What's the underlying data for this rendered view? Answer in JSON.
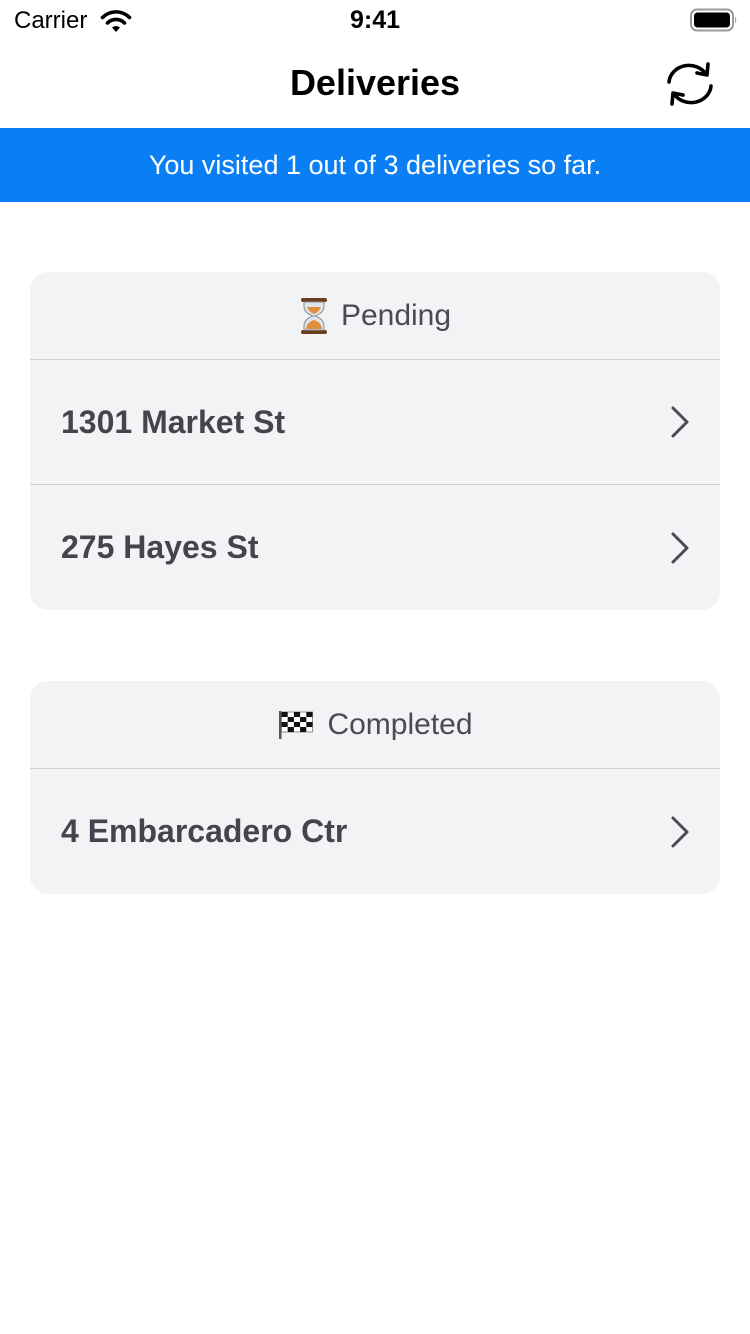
{
  "status_bar": {
    "carrier": "Carrier",
    "time": "9:41"
  },
  "nav": {
    "title": "Deliveries",
    "refresh_icon": "refresh-icon"
  },
  "banner": {
    "text": "You visited 1 out of 3 deliveries so far.",
    "color": "#0a7ff5"
  },
  "sections": [
    {
      "title": "Pending",
      "icon": "hourglass-icon",
      "items": [
        {
          "label": "1301 Market St"
        },
        {
          "label": "275 Hayes St"
        }
      ]
    },
    {
      "title": "Completed",
      "icon": "checkered-flag-icon",
      "items": [
        {
          "label": "4 Embarcadero Ctr"
        }
      ]
    }
  ]
}
